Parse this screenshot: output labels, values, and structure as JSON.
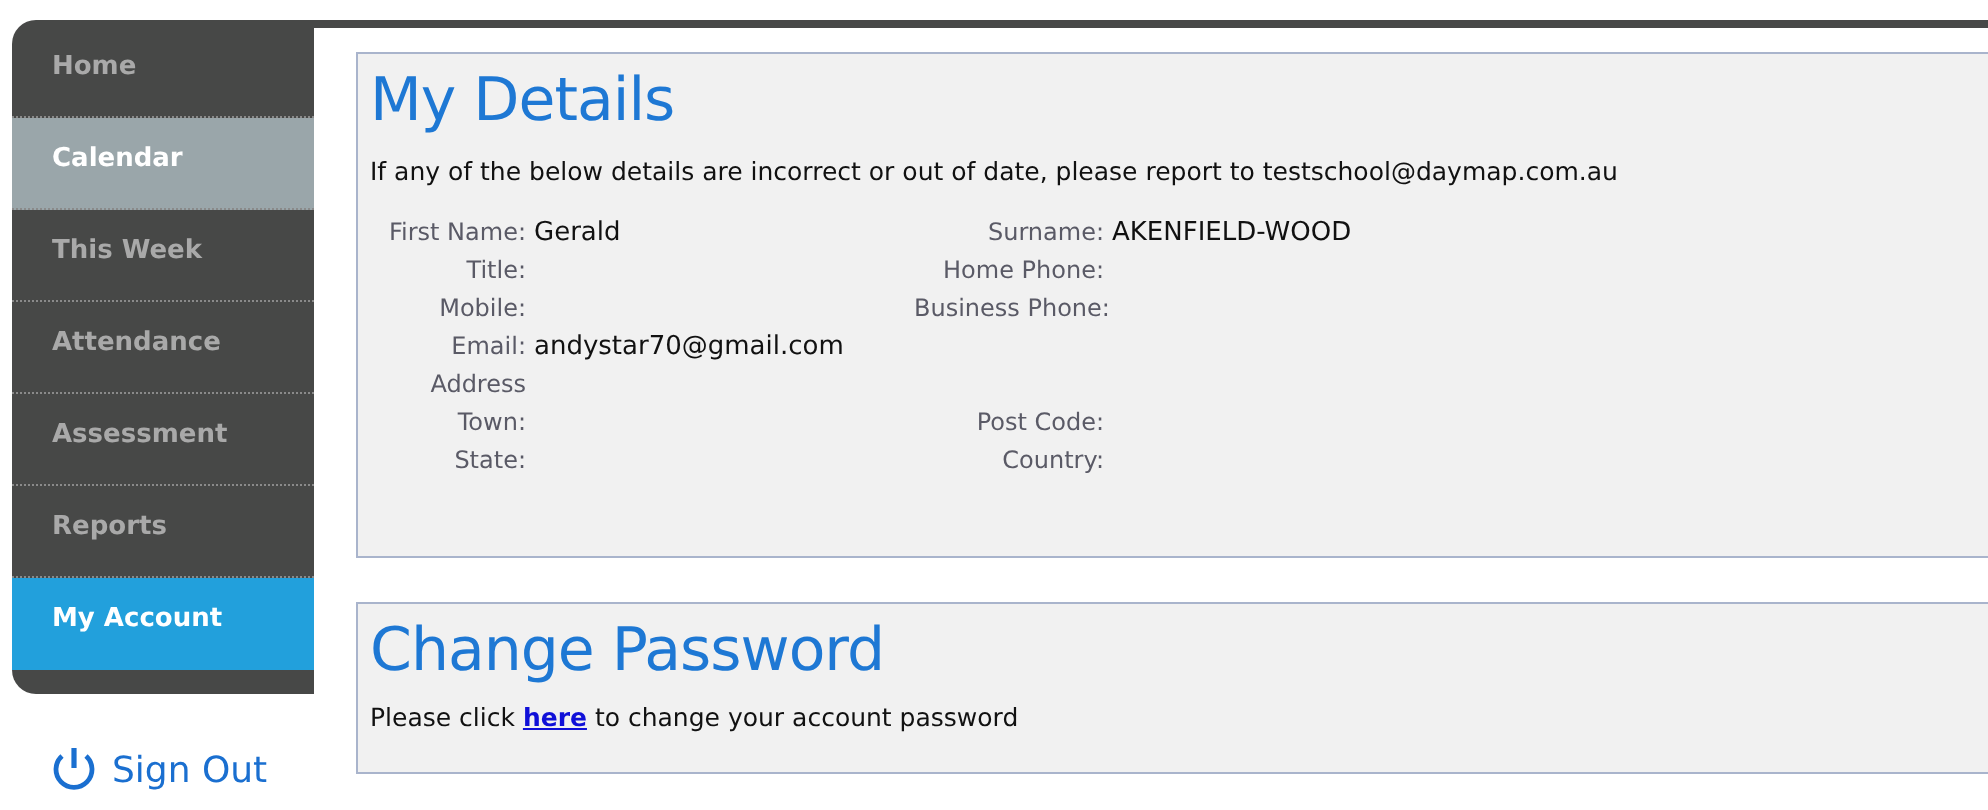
{
  "sidebar": {
    "items": [
      {
        "label": "Home",
        "selected": false,
        "hovered": false
      },
      {
        "label": "Calendar",
        "selected": false,
        "hovered": true
      },
      {
        "label": "This Week",
        "selected": false,
        "hovered": false
      },
      {
        "label": "Attendance",
        "selected": false,
        "hovered": false
      },
      {
        "label": "Assessment",
        "selected": false,
        "hovered": false
      },
      {
        "label": "Reports",
        "selected": false,
        "hovered": false
      },
      {
        "label": "My Account",
        "selected": true,
        "hovered": false
      }
    ],
    "sign_out": "Sign Out"
  },
  "details": {
    "title": "My Details",
    "notice": "If any of the below details are incorrect or out of date, please report to testschool@daymap.com.au",
    "rows": [
      {
        "left": {
          "label": "First Name:",
          "value": "Gerald"
        },
        "right": {
          "label": "Surname:",
          "value": "AKENFIELD-WOOD"
        }
      },
      {
        "left": {
          "label": "Title:"
        },
        "right": {
          "label": "Home Phone:"
        }
      },
      {
        "left": {
          "label": "Mobile:"
        },
        "right": {
          "label": "Business Phone:"
        }
      },
      {
        "left": {
          "label": "Email:",
          "value": "andystar70@gmail.com"
        }
      },
      {
        "left": {
          "label": "Address"
        }
      },
      {
        "left": {
          "label": "Town:"
        },
        "right": {
          "label": "Post Code:"
        }
      },
      {
        "left": {
          "label": "State:"
        },
        "right": {
          "label": "Country:"
        }
      }
    ]
  },
  "password": {
    "title": "Change Password",
    "text_before": "Please click",
    "link": "here",
    "text_after": "to change your account password"
  }
}
